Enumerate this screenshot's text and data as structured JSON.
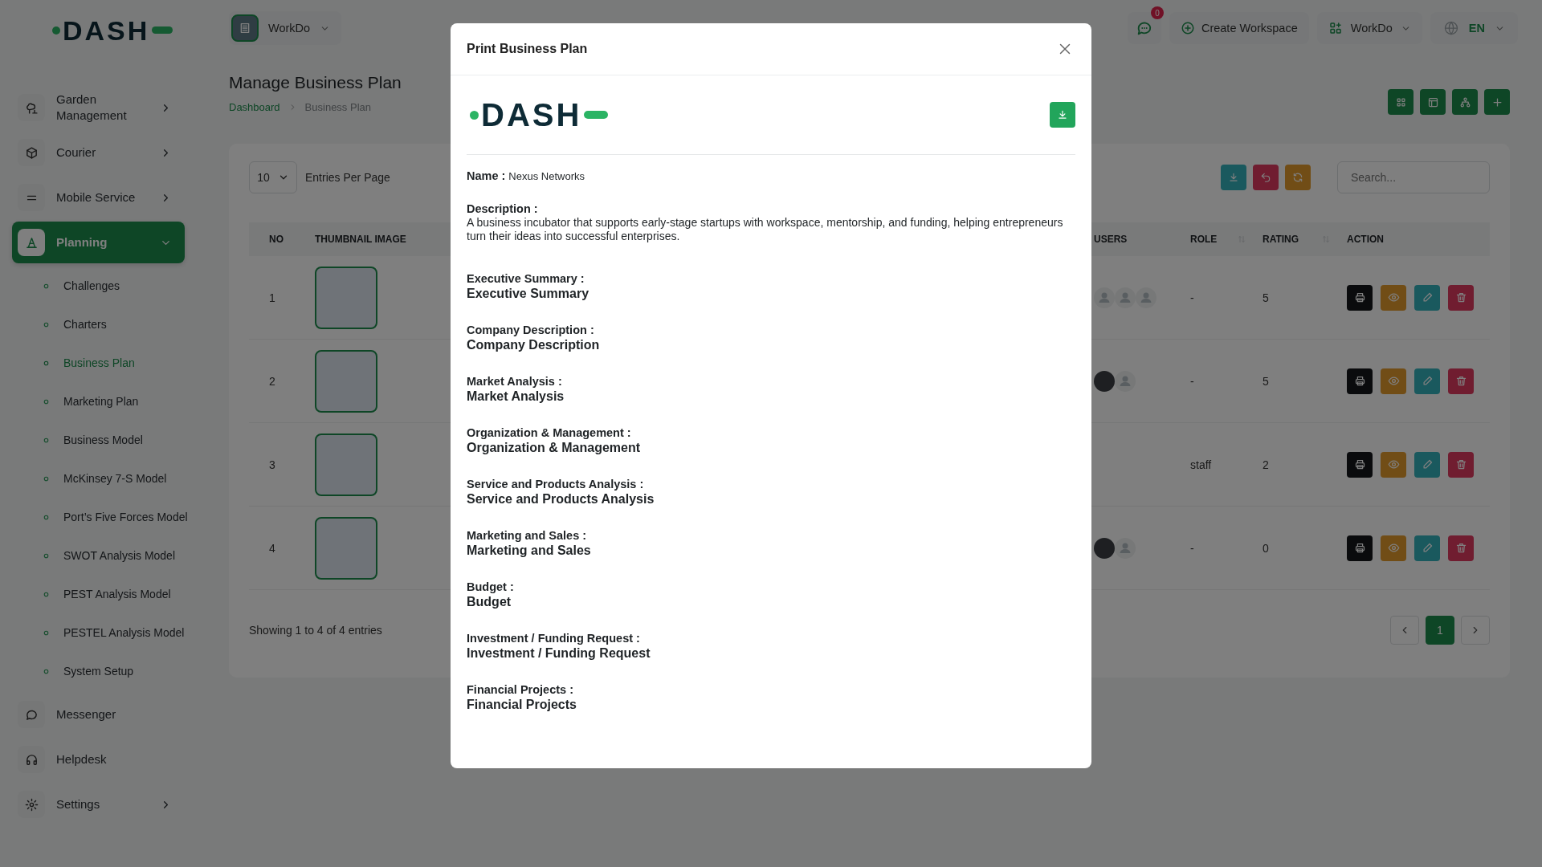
{
  "header": {
    "workspace_button": "WorkDo",
    "notification_count": "0",
    "create_workspace": "Create Workspace",
    "workspace_menu": "WorkDo",
    "language": "EN"
  },
  "sidebar": {
    "logo": "DASH",
    "items": [
      {
        "label": "Garden Management",
        "kind": "group",
        "expanded": false,
        "selected": false
      },
      {
        "label": "Courier",
        "kind": "group",
        "expanded": false,
        "selected": false
      },
      {
        "label": "Mobile Service",
        "kind": "group",
        "expanded": false,
        "selected": false
      },
      {
        "label": "Planning",
        "kind": "group",
        "expanded": true,
        "selected": true,
        "children": [
          {
            "label": "Challenges",
            "selected": false
          },
          {
            "label": "Charters",
            "selected": false
          },
          {
            "label": "Business Plan",
            "selected": true
          },
          {
            "label": "Marketing Plan",
            "selected": false
          },
          {
            "label": "Business Model",
            "selected": false
          },
          {
            "label": "McKinsey 7-S Model",
            "selected": false
          },
          {
            "label": "Port’s Five Forces Model",
            "selected": false
          },
          {
            "label": "SWOT Analysis Model",
            "selected": false
          },
          {
            "label": "PEST Analysis Model",
            "selected": false
          },
          {
            "label": "PESTEL Analysis Model",
            "selected": false
          },
          {
            "label": "System Setup",
            "selected": false
          }
        ]
      },
      {
        "label": "Messenger",
        "kind": "link",
        "selected": false
      },
      {
        "label": "Helpdesk",
        "kind": "link",
        "selected": false
      },
      {
        "label": "Settings",
        "kind": "group",
        "expanded": false,
        "selected": false
      }
    ]
  },
  "page": {
    "title": "Manage Business Plan",
    "breadcrumb": [
      "Dashboard",
      "Business Plan"
    ]
  },
  "table": {
    "entries": "10",
    "entries_label": "Entries Per Page",
    "search": {
      "placeholder": "Search..."
    },
    "columns": [
      {
        "label": "NO",
        "sortable": false
      },
      {
        "label": "THUMBNAIL IMAGE",
        "sortable": false
      },
      {
        "label": "USERS",
        "sortable": false
      },
      {
        "label": "ROLE",
        "sortable": true
      },
      {
        "label": "RATING",
        "sortable": true
      },
      {
        "label": "ACTION",
        "sortable": false
      }
    ],
    "rows": [
      {
        "no": "1",
        "users": [
          {
            "kind": "placeholder"
          },
          {
            "kind": "placeholder"
          },
          {
            "kind": "placeholder"
          }
        ],
        "role": "-",
        "rating": "5"
      },
      {
        "no": "2",
        "users": [
          {
            "kind": "photo"
          },
          {
            "kind": "placeholder"
          }
        ],
        "role": "-",
        "rating": "5"
      },
      {
        "no": "3",
        "role": "staff",
        "rating": "2"
      },
      {
        "no": "4",
        "users": [
          {
            "kind": "photo"
          },
          {
            "kind": "placeholder"
          }
        ],
        "role": "-",
        "rating": "0"
      }
    ],
    "summary": "Showing 1 to 4 of 4 entries",
    "pagination": [
      {
        "label": "1",
        "selected": true
      }
    ]
  },
  "modal": {
    "title": "Print Business Plan",
    "logo": "DASH",
    "sections": [
      {
        "kind": "inline",
        "label": "Name :",
        "value": "Nexus Networks"
      },
      {
        "kind": "paragraph",
        "label": "Description :",
        "value": "A business incubator that supports early-stage startups with workspace, mentorship, and funding, helping entrepreneurs turn their ideas into successful enterprises."
      },
      {
        "kind": "heading",
        "label": "Executive Summary :",
        "value": "Executive Summary"
      },
      {
        "kind": "heading",
        "label": "Company Description :",
        "value": "Company Description"
      },
      {
        "kind": "heading",
        "label": "Market Analysis :",
        "value": "Market Analysis"
      },
      {
        "kind": "heading",
        "label": "Organization & Management :",
        "value": "Organization & Management"
      },
      {
        "kind": "heading",
        "label": "Service and Products Analysis :",
        "value": "Service and Products Analysis"
      },
      {
        "kind": "heading",
        "label": "Marketing and Sales :",
        "value": "Marketing and Sales"
      },
      {
        "kind": "heading",
        "label": "Budget :",
        "value": "Budget"
      },
      {
        "kind": "heading",
        "label": "Investment / Funding Request :",
        "value": "Investment / Funding Request"
      },
      {
        "kind": "heading",
        "label": "Financial Projects :",
        "value": "Financial Projects"
      }
    ]
  }
}
